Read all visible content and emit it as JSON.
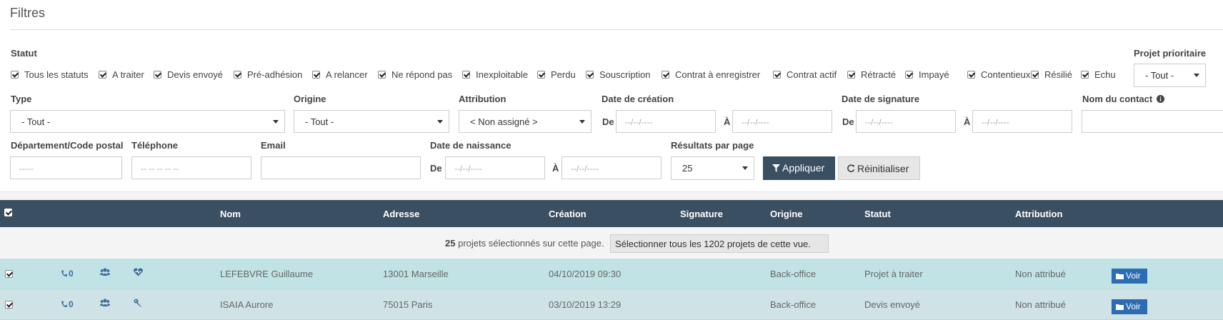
{
  "filters": {
    "title": "Filtres",
    "statut_label": "Statut",
    "statuses": [
      {
        "label": "Tous les statuts",
        "checked": true
      },
      {
        "label": "A traiter",
        "checked": true
      },
      {
        "label": "Devis envoyé",
        "checked": true
      },
      {
        "label": "Pré-adhésion",
        "checked": true
      },
      {
        "label": "A relancer",
        "checked": true
      },
      {
        "label": "Ne répond pas",
        "checked": true
      },
      {
        "label": "Inexploitable",
        "checked": true
      },
      {
        "label": "Perdu",
        "checked": true
      },
      {
        "label": "Souscription",
        "checked": true
      },
      {
        "label": "Contrat à enregistrer",
        "checked": true
      },
      {
        "label": "Contrat actif",
        "checked": true
      },
      {
        "label": "Rétracté",
        "checked": true
      },
      {
        "label": "Impayé",
        "checked": true
      },
      {
        "label": "Contentieux",
        "checked": true
      },
      {
        "label": "Résilié",
        "checked": true
      },
      {
        "label": "Echu",
        "checked": true
      }
    ],
    "projet_prioritaire": {
      "label": "Projet prioritaire",
      "value": "- Tout -"
    },
    "type": {
      "label": "Type",
      "value": "- Tout -"
    },
    "origine": {
      "label": "Origine",
      "value": "- Tout -"
    },
    "attribution": {
      "label": "Attribution",
      "value": "< Non assigné >"
    },
    "date_creation": {
      "label": "Date de création",
      "from_prefix": "De",
      "to_prefix": "À",
      "from_placeholder": "--/--/----",
      "to_placeholder": "--/--/----"
    },
    "date_signature": {
      "label": "Date de signature",
      "from_prefix": "De",
      "to_prefix": "À",
      "from_placeholder": "--/--/----",
      "to_placeholder": "--/--/----"
    },
    "nom_contact": {
      "label": "Nom du contact",
      "info_icon": "info-circle-icon"
    },
    "departement": {
      "label": "Département/Code postal",
      "placeholder": "-----"
    },
    "telephone": {
      "label": "Téléphone",
      "placeholder": "-- -- -- -- --"
    },
    "email": {
      "label": "Email",
      "placeholder": ""
    },
    "date_naissance": {
      "label": "Date de naissance",
      "from_prefix": "De",
      "to_prefix": "À",
      "from_placeholder": "--/--/----",
      "to_placeholder": "--/--/----"
    },
    "resultats": {
      "label": "Résultats par page",
      "value": "25"
    },
    "apply_label": "Appliquer",
    "reset_label": "Réinitialiser"
  },
  "table": {
    "columns": {
      "nom": "Nom",
      "adresse": "Adresse",
      "creation": "Création",
      "signature": "Signature",
      "origine": "Origine",
      "statut": "Statut",
      "attribution": "Attribution"
    },
    "selection": {
      "count": "25",
      "text": "projets sélectionnés sur cette page.",
      "button": "Sélectionner tous les 1202 projets de cette vue."
    },
    "rows": [
      {
        "checked": true,
        "calls": "0",
        "nom": "LEFEBVRE Guillaume",
        "adresse": "13001 Marseille",
        "creation": "04/10/2019 09:30",
        "signature": "",
        "origine": "Back-office",
        "statut": "Projet à traiter",
        "attribution": "Non attribué",
        "voir": "Voir",
        "type_icon": "heartbeat-icon",
        "bg": "#c2e3e6"
      },
      {
        "checked": true,
        "calls": "0",
        "nom": "ISAIA Aurore",
        "adresse": "75015 Paris",
        "creation": "03/10/2019 13:29",
        "signature": "",
        "origine": "Back-office",
        "statut": "Devis envoyé",
        "attribution": "Non attribué",
        "voir": "Voir",
        "type_icon": "key-icon",
        "bg": "#cfe3e6"
      }
    ]
  },
  "colors": {
    "header_bg": "#3b4f63",
    "button_primary": "#2b6db2",
    "row_bg": "#c2e3e6"
  }
}
